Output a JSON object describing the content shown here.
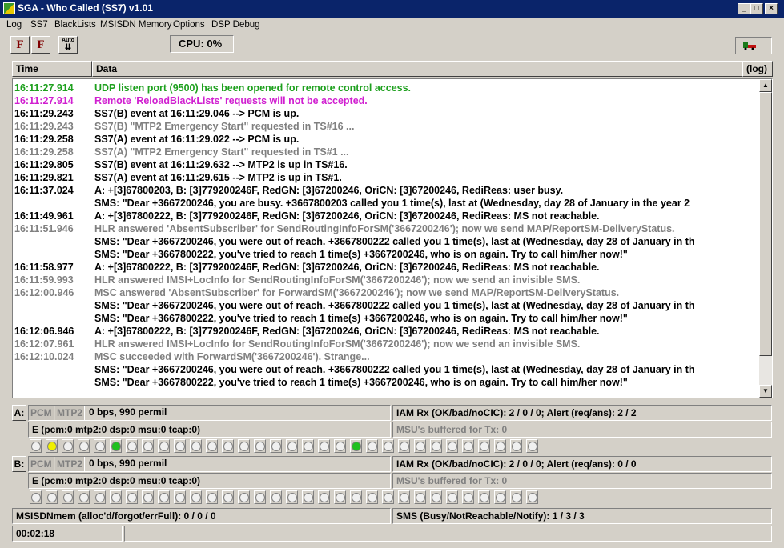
{
  "window": {
    "title": "SGA - Who Called  (SS7)  v1.01"
  },
  "menu": [
    "Log",
    "SS7",
    "BlackLists",
    "MSISDN Memory",
    "Options",
    "DSP Debug"
  ],
  "toolbar": {
    "btn1": "F",
    "btn2": "F",
    "btn3": "Auto"
  },
  "cpu": {
    "label": "CPU:  0%"
  },
  "header": {
    "time": "Time",
    "data": "Data",
    "log_btn": "(log)"
  },
  "colors": {
    "green": "#1ea01e",
    "magenta": "#d01fd0",
    "gray": "#808080",
    "black": "#000000",
    "lamp_yellow": "#f0f000",
    "lamp_green": "#20c020"
  },
  "log_rows": [
    {
      "time": "16:11:27.914",
      "text": "UDP listen port (9500) has been opened for remote control access.",
      "color": "#1ea01e"
    },
    {
      "time": "16:11:27.914",
      "text": "Remote 'ReloadBlackLists' requests will not be accepted.",
      "color": "#d01fd0"
    },
    {
      "time": "16:11:29.243",
      "text": "SS7(B) event at 16:11:29.046 --> PCM is up.",
      "color": "#000000"
    },
    {
      "time": "16:11:29.243",
      "text": "SS7(B) \"MTP2 Emergency Start\" requested in TS#16 ...",
      "color": "#808080"
    },
    {
      "time": "16:11:29.258",
      "text": "SS7(A) event at 16:11:29.022 --> PCM is up.",
      "color": "#000000"
    },
    {
      "time": "16:11:29.258",
      "text": "SS7(A) \"MTP2 Emergency Start\" requested in TS#1 ...",
      "color": "#808080"
    },
    {
      "time": "16:11:29.805",
      "text": "SS7(B) event at 16:11:29.632 --> MTP2 is up in TS#16.",
      "color": "#000000"
    },
    {
      "time": "16:11:29.821",
      "text": "SS7(A) event at 16:11:29.615 --> MTP2 is up in TS#1.",
      "color": "#000000"
    },
    {
      "time": "16:11:37.024",
      "text": "A: +[3]67800203,  B: [3]779200246F,  RedGN: [3]67200246,  OriCN: [3]67200246,   RediReas: user busy.",
      "color": "#000000"
    },
    {
      "time": "",
      "text": "SMS: \"Dear +3667200246, you are busy. +3667800203 called you 1 time(s), last at (Wednesday, day 28 of January in the year 2",
      "color": "#000000"
    },
    {
      "time": "16:11:49.961",
      "text": "A: +[3]67800222,  B: [3]779200246F,  RedGN: [3]67200246,  OriCN: [3]67200246,   RediReas: MS not reachable.",
      "color": "#000000"
    },
    {
      "time": "16:11:51.946",
      "text": "HLR answered 'AbsentSubscriber' for SendRoutingInfoForSM('3667200246'); now we send MAP/ReportSM-DeliveryStatus.",
      "color": "#808080"
    },
    {
      "time": "",
      "text": "SMS: \"Dear +3667200246, you were out of reach. +3667800222 called you 1 time(s), last at (Wednesday, day 28 of January in th",
      "color": "#000000"
    },
    {
      "time": "",
      "text": "SMS: \"Dear +3667800222, you've tried to reach 1 time(s) +3667200246, who is on again. Try to call him/her now!\"",
      "color": "#000000"
    },
    {
      "time": "16:11:58.977",
      "text": "A: +[3]67800222,  B: [3]779200246F,  RedGN: [3]67200246,  OriCN: [3]67200246,   RediReas: MS not reachable.",
      "color": "#000000"
    },
    {
      "time": "16:11:59.993",
      "text": "HLR answered IMSI+LocInfo for SendRoutingInfoForSM('3667200246'); now we send an invisible SMS.",
      "color": "#808080"
    },
    {
      "time": "16:12:00.946",
      "text": "MSC answered 'AbsentSubscriber' for ForwardSM('3667200246'); now we send MAP/ReportSM-DeliveryStatus.",
      "color": "#808080"
    },
    {
      "time": "",
      "text": "SMS: \"Dear +3667200246, you were out of reach. +3667800222 called you 1 time(s), last at (Wednesday, day 28 of January in th",
      "color": "#000000"
    },
    {
      "time": "",
      "text": "SMS: \"Dear +3667800222, you've tried to reach 1 time(s) +3667200246, who is on again. Try to call him/her now!\"",
      "color": "#000000"
    },
    {
      "time": "16:12:06.946",
      "text": "A: +[3]67800222,  B: [3]779200246F,  RedGN: [3]67200246,  OriCN: [3]67200246,   RediReas: MS not reachable.",
      "color": "#000000"
    },
    {
      "time": "16:12:07.961",
      "text": "HLR answered IMSI+LocInfo for SendRoutingInfoForSM('3667200246'); now we send an invisible SMS.",
      "color": "#808080"
    },
    {
      "time": "16:12:10.024",
      "text": "MSC succeeded with ForwardSM('3667200246'). Strange...",
      "color": "#808080"
    },
    {
      "time": "",
      "text": "SMS: \"Dear +3667200246, you were out of reach. +3667800222 called you 1 time(s), last at (Wednesday, day 28 of January in th",
      "color": "#000000"
    },
    {
      "time": "",
      "text": "SMS: \"Dear +3667800222, you've tried to reach 1 time(s) +3667200246, who is on again. Try to call him/her now!\"",
      "color": "#000000"
    }
  ],
  "channels": [
    {
      "label": "A:",
      "pcm": "PCM",
      "mtp2": "MTP2",
      "rate": "0 bps, 990 permil",
      "errors": "E (pcm:0  mtp2:0  dsp:0  msu:0  tcap:0)",
      "iam": "IAM Rx (OK/bad/noCIC): 2 / 0 / 0;  Alert (req/ans): 2 / 2",
      "msu": "MSU's buffered for Tx: 0",
      "lamps": [
        "off",
        "on-yellow",
        "off",
        "off",
        "off",
        "on-green",
        "off",
        "off",
        "off",
        "off",
        "off",
        "off",
        "off",
        "off",
        "off",
        "off",
        "off",
        "off",
        "off",
        "off",
        "on-green",
        "off",
        "off",
        "off",
        "off",
        "off",
        "off",
        "off",
        "off",
        "off",
        "off",
        "off",
        "off",
        "off",
        "off",
        "off",
        "off",
        "off",
        "off",
        "off",
        "off",
        "off",
        "off",
        "off",
        "off",
        "off",
        "off",
        "off",
        "off",
        "off",
        "off",
        "off",
        "off",
        "off",
        "off",
        "off",
        "off",
        "off",
        "off",
        "off",
        "off",
        "off",
        "off",
        "off"
      ]
    },
    {
      "label": "B:",
      "pcm": "PCM",
      "mtp2": "MTP2",
      "rate": "0 bps, 990 permil",
      "errors": "E (pcm:0  mtp2:0  dsp:0  msu:0  tcap:0)",
      "iam": "IAM Rx (OK/bad/noCIC): 2 / 0 / 0;  Alert (req/ans): 0 / 0",
      "msu": "MSU's buffered for Tx: 0",
      "lamps": [
        "off",
        "off",
        "off",
        "off",
        "off",
        "off",
        "off",
        "off",
        "off",
        "off",
        "off",
        "off",
        "off",
        "off",
        "off",
        "off",
        "off",
        "off",
        "off",
        "off",
        "off",
        "off",
        "off",
        "off",
        "off",
        "off",
        "off",
        "off",
        "off",
        "off",
        "off",
        "off",
        "off",
        "off",
        "off",
        "off",
        "off",
        "off",
        "off",
        "off",
        "off",
        "off",
        "off",
        "off",
        "off",
        "off",
        "off",
        "off",
        "off",
        "off",
        "off",
        "off",
        "off",
        "off",
        "off",
        "off",
        "off",
        "off",
        "off",
        "off",
        "off",
        "off",
        "off",
        "off"
      ]
    }
  ],
  "bottom": {
    "msisdn": "MSISDNmem (alloc'd/forgot/errFull): 0 / 0 / 0",
    "sms": "SMS (Busy/NotReachable/Notify): 1 / 3 / 3",
    "elapsed": "00:02:18"
  }
}
